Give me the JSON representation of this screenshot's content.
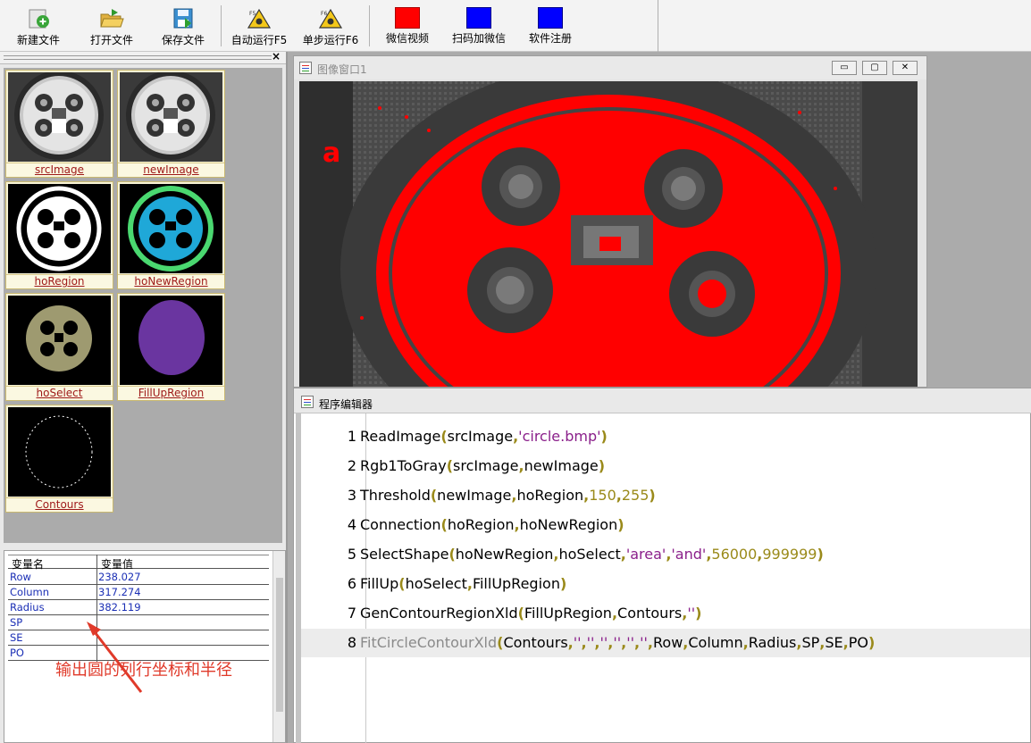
{
  "toolbar": {
    "buttons": [
      {
        "label": "新建文件",
        "icon": "new-file-icon"
      },
      {
        "label": "打开文件",
        "icon": "open-folder-icon"
      },
      {
        "label": "保存文件",
        "icon": "save-disk-icon"
      },
      {
        "label": "自动运行F5",
        "icon": "auto-run-warning-icon"
      },
      {
        "label": "单步运行F6",
        "icon": "step-run-warning-icon"
      },
      {
        "label": "微信视频",
        "icon": "red-square-icon"
      },
      {
        "label": "扫码加微信",
        "icon": "blue-square-icon"
      },
      {
        "label": "软件注册",
        "icon": "blue-square-icon"
      }
    ],
    "colors": {
      "red": "#ff0000",
      "blue": "#0000ff"
    }
  },
  "thumbnails": [
    {
      "label": "srcImage"
    },
    {
      "label": "newImage"
    },
    {
      "label": "hoRegion"
    },
    {
      "label": "hoNewRegion"
    },
    {
      "label": "hoSelect"
    },
    {
      "label": "FillUpRegion"
    },
    {
      "label": "Contours"
    }
  ],
  "variables": {
    "header": {
      "name": "变量名",
      "value": "变量值"
    },
    "rows": [
      {
        "name": "Row",
        "value": "238.027"
      },
      {
        "name": "Column",
        "value": "317.274"
      },
      {
        "name": "Radius",
        "value": "382.119"
      },
      {
        "name": "SP",
        "value": ""
      },
      {
        "name": "SE",
        "value": ""
      },
      {
        "name": "PO",
        "value": ""
      }
    ]
  },
  "annotation": {
    "text": "输出圆的列行坐标和半径"
  },
  "image_window": {
    "title": "图像窗口1",
    "buttons": {
      "minimize": "▭",
      "maximize": "▢",
      "close": "✕"
    }
  },
  "editor": {
    "title": "程序编辑器",
    "lines": [
      {
        "num": "1",
        "fn": "ReadImage",
        "args": [
          {
            "t": "id",
            "v": "srcImage"
          },
          {
            "t": "str",
            "v": "'circle.bmp'"
          }
        ]
      },
      {
        "num": "2",
        "fn": "Rgb1ToGray",
        "args": [
          {
            "t": "id",
            "v": "srcImage"
          },
          {
            "t": "id",
            "v": "newImage"
          }
        ]
      },
      {
        "num": "3",
        "fn": "Threshold",
        "args": [
          {
            "t": "id",
            "v": "newImage"
          },
          {
            "t": "id",
            "v": "hoRegion"
          },
          {
            "t": "num",
            "v": "150"
          },
          {
            "t": "num",
            "v": "255"
          }
        ]
      },
      {
        "num": "4",
        "fn": "Connection",
        "args": [
          {
            "t": "id",
            "v": "hoRegion"
          },
          {
            "t": "id",
            "v": "hoNewRegion"
          }
        ]
      },
      {
        "num": "5",
        "fn": "SelectShape",
        "args": [
          {
            "t": "id",
            "v": "hoNewRegion"
          },
          {
            "t": "id",
            "v": "hoSelect"
          },
          {
            "t": "str",
            "v": "'area'"
          },
          {
            "t": "str",
            "v": "'and'"
          },
          {
            "t": "num",
            "v": "56000"
          },
          {
            "t": "num",
            "v": "999999"
          }
        ]
      },
      {
        "num": "6",
        "fn": "FillUp",
        "args": [
          {
            "t": "id",
            "v": "hoSelect"
          },
          {
            "t": "id",
            "v": "FillUpRegion"
          }
        ]
      },
      {
        "num": "7",
        "fn": "GenContourRegionXld",
        "args": [
          {
            "t": "id",
            "v": "FillUpRegion"
          },
          {
            "t": "id",
            "v": "Contours"
          },
          {
            "t": "str",
            "v": "''"
          }
        ]
      },
      {
        "num": "8",
        "fn": "FitCircleContourXld",
        "current": true,
        "args": [
          {
            "t": "id",
            "v": "Contours"
          },
          {
            "t": "str",
            "v": "''"
          },
          {
            "t": "str",
            "v": "''"
          },
          {
            "t": "str",
            "v": "''"
          },
          {
            "t": "str",
            "v": "''"
          },
          {
            "t": "str",
            "v": "''"
          },
          {
            "t": "str",
            "v": "''"
          },
          {
            "t": "id",
            "v": "Row"
          },
          {
            "t": "id",
            "v": "Column"
          },
          {
            "t": "id",
            "v": "Radius"
          },
          {
            "t": "id",
            "v": "SP"
          },
          {
            "t": "id",
            "v": "SE"
          },
          {
            "t": "id",
            "v": "PO"
          }
        ]
      }
    ]
  }
}
